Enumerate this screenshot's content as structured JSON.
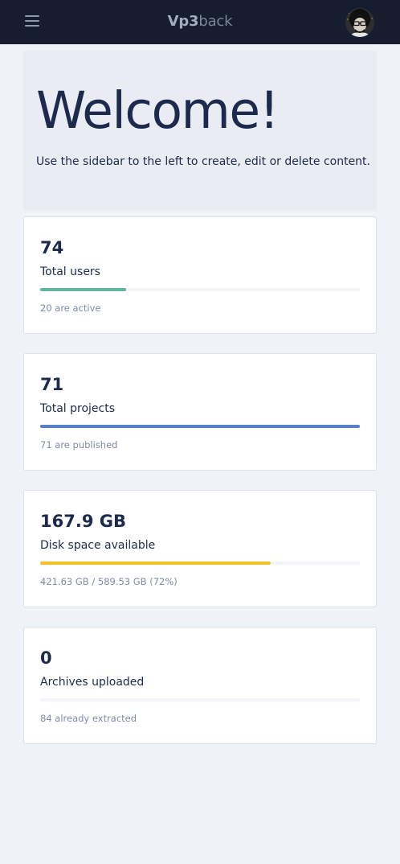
{
  "header": {
    "brand_bold": "Vp3",
    "brand_light": "back",
    "menu_icon": "hamburger-menu-icon",
    "avatar_icon": "user-avatar"
  },
  "welcome": {
    "title": "Welcome!",
    "text": "Use the sidebar to the left to create, edit or delete content."
  },
  "stats": [
    {
      "value": "74",
      "label": "Total users",
      "note": "20 are active",
      "progress": 0.27,
      "color": "#5cb895"
    },
    {
      "value": "71",
      "label": "Total projects",
      "note": "71 are published",
      "progress": 1.0,
      "color": "#5680c8"
    },
    {
      "value": "167.9 GB",
      "label": "Disk space available",
      "note": "421.63 GB / 589.53 GB (72%)",
      "progress": 0.72,
      "color": "#f3c12b"
    },
    {
      "value": "0",
      "label": "Archives uploaded",
      "note": "84 already extracted",
      "progress": 0.0,
      "color": "#5cb895"
    }
  ]
}
